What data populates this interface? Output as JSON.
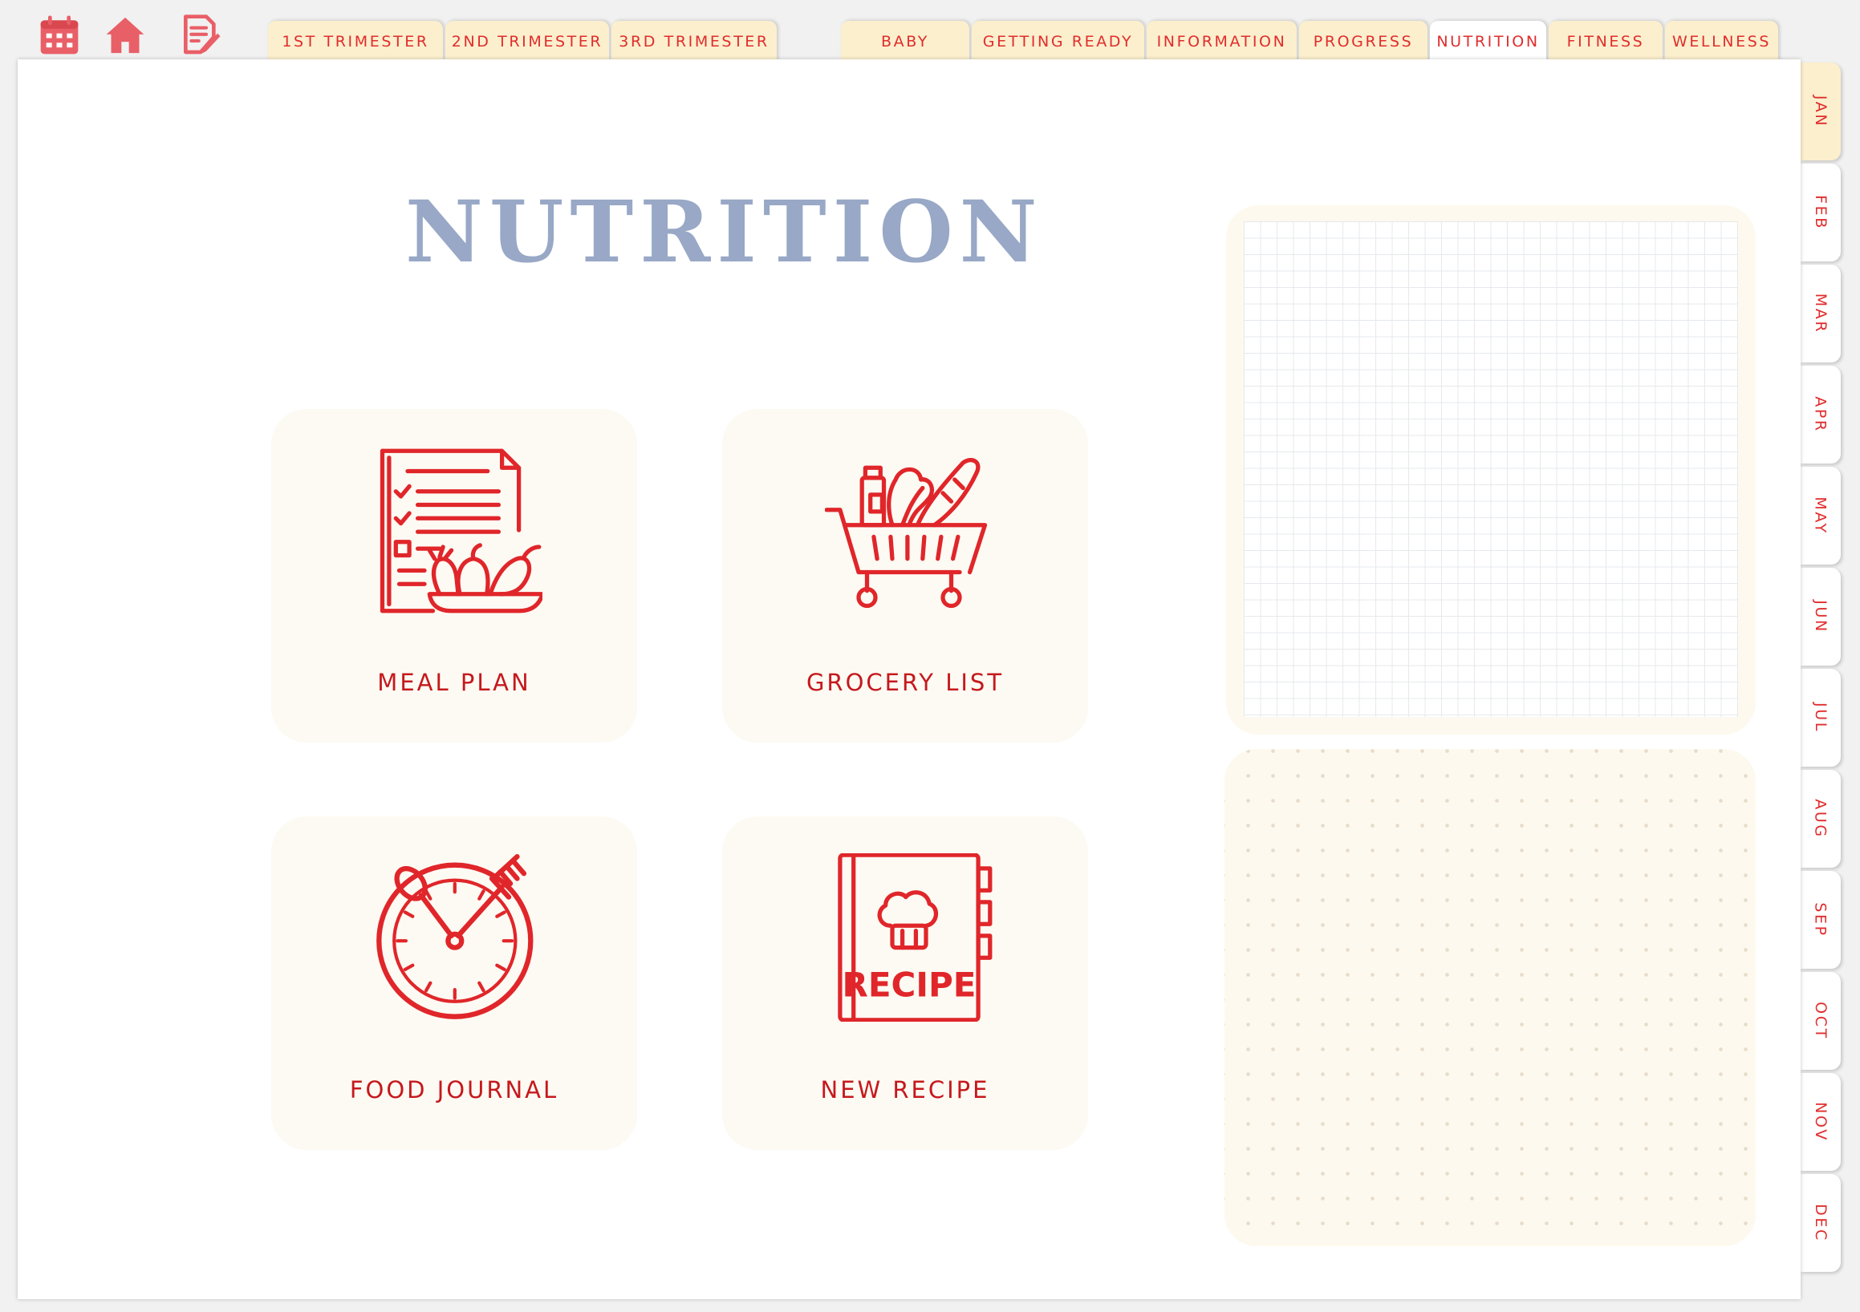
{
  "top_icons": [
    {
      "name": "calendar-icon",
      "color": "#e95f67"
    },
    {
      "name": "home-icon",
      "color": "#e95f67"
    },
    {
      "name": "notes-icon",
      "color": "#e95f67"
    }
  ],
  "trimester_tabs": [
    {
      "label": "1ST TRIMESTER"
    },
    {
      "label": "2ND TRIMESTER"
    },
    {
      "label": "3RD TRIMESTER"
    }
  ],
  "section_tabs": [
    {
      "label": "BABY"
    },
    {
      "label": "GETTING READY"
    },
    {
      "label": "INFORMATION"
    },
    {
      "label": "PROGRESS"
    },
    {
      "label": "NUTRITION"
    },
    {
      "label": "FITNESS"
    },
    {
      "label": "WELLNESS"
    }
  ],
  "month_tabs": [
    "JAN",
    "FEB",
    "MAR",
    "APR",
    "MAY",
    "JUN",
    "JUL",
    "AUG",
    "SEP",
    "OCT",
    "NOV",
    "DEC"
  ],
  "page": {
    "title": "NUTRITION"
  },
  "cards": [
    {
      "label": "MEAL PLAN",
      "icon": "meal-plan-icon"
    },
    {
      "label": "GROCERY LIST",
      "icon": "grocery-cart-icon"
    },
    {
      "label": "FOOD JOURNAL",
      "icon": "clock-cutlery-icon"
    },
    {
      "label": "NEW RECIPE",
      "icon": "recipe-book-icon",
      "icon_text": "RECIPE"
    }
  ],
  "colors": {
    "accent_red": "#e02d2d",
    "icon_red": "#e0262a",
    "tab_cream": "#fcefcd",
    "card_bg": "#fdfaf3",
    "title_blue": "#98a8c6"
  }
}
